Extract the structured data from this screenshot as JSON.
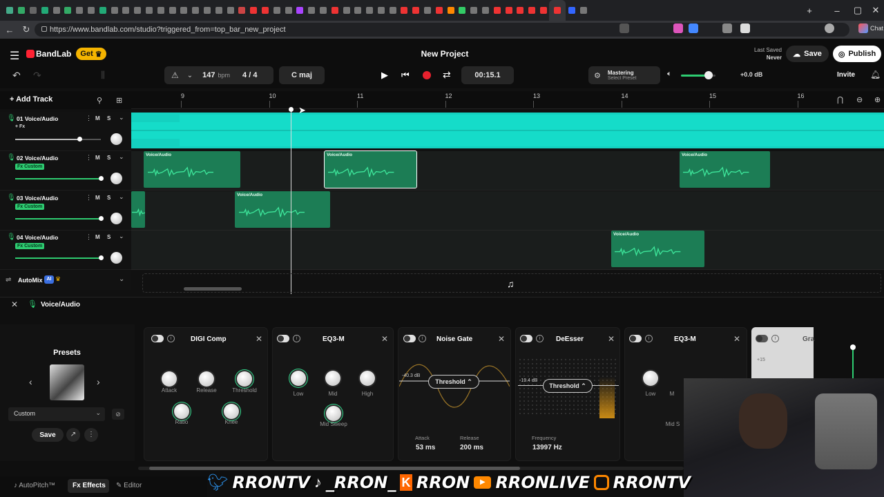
{
  "browser": {
    "url": "https://www.bandlab.com/studio?triggered_from=top_bar_new_project",
    "tab_colors": [
      "#4a8",
      "#3a6",
      "#666",
      "#2a7",
      "#777",
      "#3a6",
      "#777",
      "#777",
      "#2a7",
      "#777",
      "#777",
      "#777",
      "#777",
      "#777",
      "#777",
      "#777",
      "#777",
      "#777",
      "#777",
      "#777",
      "#c44",
      "#e33",
      "#e33",
      "#777",
      "#777",
      "#a4f",
      "#777",
      "#777",
      "#e33",
      "#777",
      "#777",
      "#777",
      "#777",
      "#777",
      "#e33",
      "#e33",
      "#777",
      "#e33",
      "#f80",
      "#3c6",
      "#777",
      "#777",
      "#e33",
      "#e33",
      "#e33",
      "#e33",
      "#e33",
      "#e33",
      "#36f",
      "#777"
    ],
    "chat_label": "Chat"
  },
  "header": {
    "brand": "BandLab",
    "get_label": "Get",
    "project_title": "New Project",
    "last_saved_label": "Last Saved",
    "last_saved_value": "Never",
    "save_label": "Save",
    "publish_label": "Publish",
    "invite_label": "Invite"
  },
  "transport": {
    "bpm_value": "147",
    "bpm_unit": "bpm",
    "time_signature": "4 / 4",
    "key": "C maj",
    "time": "00:15.1",
    "mastering_label": "Mastering",
    "mastering_preset": "Select Preset",
    "master_gain": "+0.0 dB",
    "master_volume_fraction": 0.8
  },
  "toolbar": {
    "add_track_label": "Add Track"
  },
  "ruler": {
    "bars": [
      "9",
      "10",
      "11",
      "12",
      "13",
      "14",
      "15",
      "16"
    ]
  },
  "tracks": [
    {
      "name": "01 Voice/Audio",
      "fx_label": "+ Fx",
      "mute": "M",
      "solo": "S",
      "volume_fraction": 0.75
    },
    {
      "name": "02 Voice/Audio",
      "fx_label": "Fx Custom",
      "mute": "M",
      "solo": "S",
      "volume_fraction": 1.0
    },
    {
      "name": "03 Voice/Audio",
      "fx_label": "Fx Custom",
      "mute": "M",
      "solo": "S",
      "volume_fraction": 1.0
    },
    {
      "name": "04 Voice/Audio",
      "fx_label": "Fx Custom",
      "mute": "M",
      "solo": "S",
      "volume_fraction": 1.0
    }
  ],
  "clips": {
    "label": "Voice/Audio"
  },
  "automix": {
    "label": "AutoMix",
    "badge": "AI"
  },
  "effects_panel": {
    "track_label": "Voice/Audio",
    "presets_label": "Presets",
    "preset_value": "Custom",
    "save_label": "Save",
    "digicomp": {
      "title": "DIGI Comp",
      "attack": "Attack",
      "release": "Release",
      "threshold": "Threshold",
      "ratio": "Ratio",
      "knee": "Knee"
    },
    "eq3": {
      "title": "EQ3-M",
      "low": "Low",
      "mid": "Mid",
      "high": "High",
      "mid_sweep": "Mid Sweep"
    },
    "noisegate": {
      "title": "Noise Gate",
      "threshold_label": "Threshold",
      "db": "-40.3 dB",
      "attack_label": "Attack",
      "attack_value": "53 ms",
      "release_label": "Release",
      "release_value": "200 ms"
    },
    "deesser": {
      "title": "DeEsser",
      "threshold_label": "Threshold",
      "db": "-19.4 dB",
      "frequency_label": "Frequency",
      "frequency_value": "13997 Hz"
    },
    "eq3b": {
      "title": "EQ3-M",
      "low": "Low",
      "mid": "M",
      "mid_sweep": "Mid S"
    },
    "graphic": {
      "title": "Gra",
      "db": "+15"
    }
  },
  "bottom_tabs": {
    "autopitch": "AutoPitch™",
    "effects": "Effects",
    "editor": "Editor"
  },
  "stream_overlay": {
    "items": [
      "RRONTV",
      "_RRON_",
      "RRON",
      "RRONLIVE",
      "RRONTV"
    ]
  }
}
